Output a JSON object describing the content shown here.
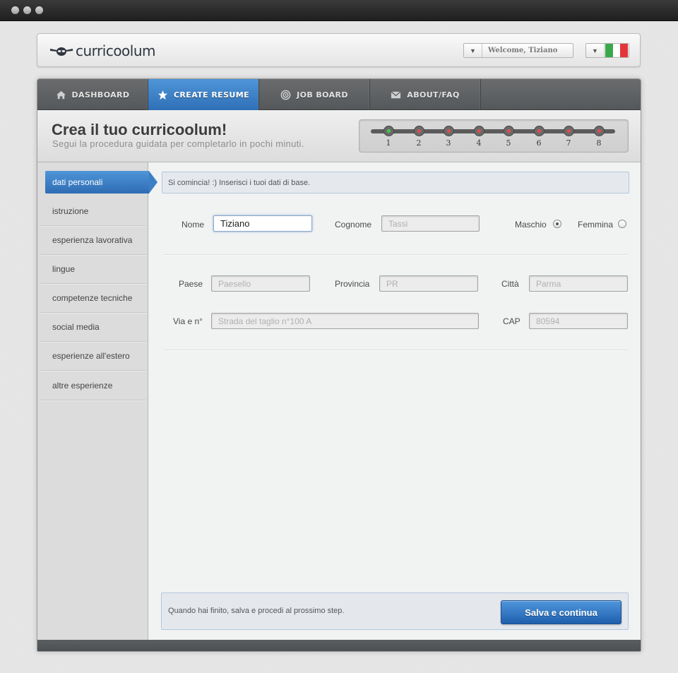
{
  "header": {
    "logo_text": "curricoolum",
    "welcome": "Welcome, Tiziano",
    "flag_colors": [
      "#3aa84a",
      "#ffffff",
      "#e2363a"
    ]
  },
  "nav": {
    "items": [
      {
        "label": "DASHBOARD",
        "icon": "home-icon"
      },
      {
        "label": "CREATE RESUME",
        "icon": "star-icon",
        "active": true
      },
      {
        "label": "JOB BOARD",
        "icon": "target-icon"
      },
      {
        "label": "ABOUT/FAQ",
        "icon": "mail-icon"
      }
    ]
  },
  "page": {
    "title": "Crea il tuo curricoolum!",
    "subtitle": "Segui la procedura guidata per completarlo in pochi minuti."
  },
  "steps": [
    "1",
    "2",
    "3",
    "4",
    "5",
    "6",
    "7",
    "8"
  ],
  "current_step": 1,
  "sidebar": {
    "items": [
      "dati personali",
      "istruzione",
      "esperienza lavorativa",
      "lingue",
      "competenze tecniche",
      "social media",
      "esperienze all'estero",
      "altre esperienze"
    ]
  },
  "info_text": "Si comincia! :) Inserisci i tuoi dati di base.",
  "form": {
    "nome_label": "Nome",
    "nome_value": "Tiziano",
    "cognome_label": "Cognome",
    "cognome_placeholder": "Tassi",
    "maschio_label": "Maschio",
    "femmina_label": "Femmina",
    "gender_selected": "Maschio",
    "paese_label": "Paese",
    "paese_placeholder": "Paesello",
    "provincia_label": "Provincia",
    "provincia_placeholder": "PR",
    "citta_label": "Città",
    "citta_placeholder": "Parma",
    "via_label": "Via e n°",
    "via_placeholder": "Strada del taglio n°100 A",
    "cap_label": "CAP",
    "cap_placeholder": "80594"
  },
  "footer": {
    "text": "Quando hai finito, salva e procedi al prossimo step.",
    "save_label": "Salva e continua"
  },
  "colors": {
    "accent": "#2f6fb6",
    "nav_bg": "#5f6264",
    "step_done": "#3fcf4b",
    "step_todo": "#e84a4a"
  }
}
